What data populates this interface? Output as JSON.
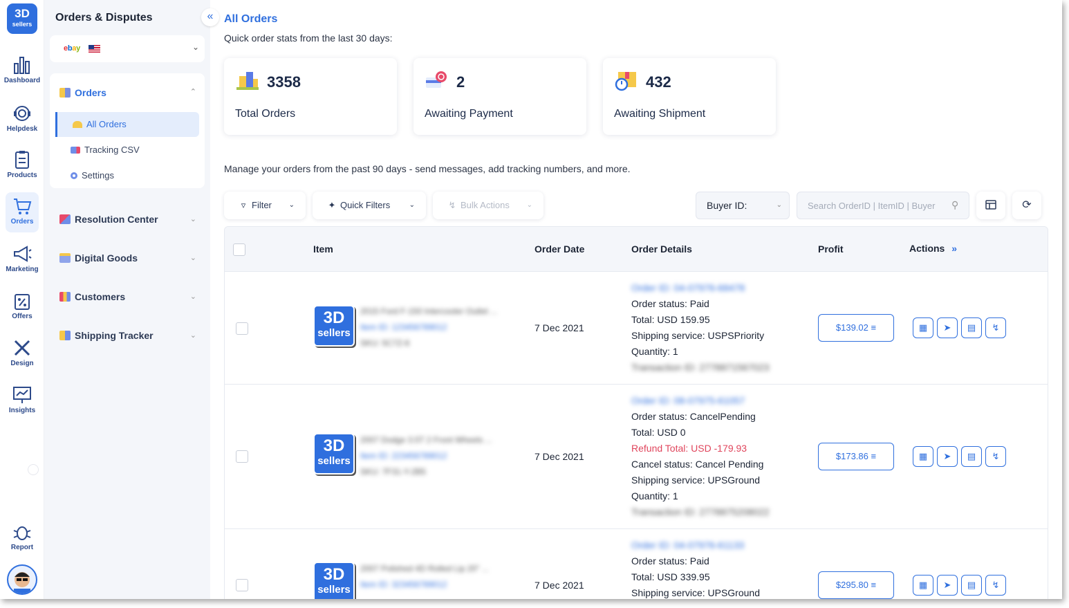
{
  "brand": {
    "logo_line1": "3D",
    "logo_line2": "sellers",
    "accent": "#2f6fde"
  },
  "rail": {
    "items": [
      {
        "label": "Dashboard",
        "icon": "bar-chart-icon"
      },
      {
        "label": "Helpdesk",
        "icon": "headset-icon"
      },
      {
        "label": "Products",
        "icon": "clipboard-icon"
      },
      {
        "label": "Orders",
        "icon": "cart-icon",
        "active": true
      },
      {
        "label": "Marketing",
        "icon": "megaphone-icon"
      },
      {
        "label": "Offers",
        "icon": "percent-tag-icon"
      },
      {
        "label": "Design",
        "icon": "design-tools-icon"
      },
      {
        "label": "Insights",
        "icon": "monitor-chart-icon"
      }
    ],
    "report_label": "Report"
  },
  "side": {
    "title": "Orders & Disputes",
    "marketplace": "ebay",
    "orders_group": "Orders",
    "orders_items": [
      "All Orders",
      "Tracking CSV",
      "Settings"
    ],
    "groups": [
      "Resolution Center",
      "Digital Goods",
      "Customers",
      "Shipping Tracker"
    ]
  },
  "main": {
    "title": "All Orders",
    "stats_subtitle": "Quick order stats from the last 30 days:",
    "stats": [
      {
        "value": "3358",
        "label": "Total Orders",
        "icon": "boxes-icon"
      },
      {
        "value": "2",
        "label": "Awaiting Payment",
        "icon": "card-clock-icon"
      },
      {
        "value": "432",
        "label": "Awaiting Shipment",
        "icon": "package-timer-icon"
      }
    ],
    "manage_text": "Manage your orders from the past 90 days - send messages, add tracking numbers, and more.",
    "toolbar": {
      "filter": "Filter",
      "quick_filters": "Quick Filters",
      "bulk_actions": "Bulk Actions",
      "buyer_id": "Buyer ID:",
      "search_placeholder": "Search OrderID | ItemID | Buyer"
    }
  },
  "table": {
    "headers": {
      "item": "Item",
      "order_date": "Order Date",
      "order_details": "Order Details",
      "profit": "Profit",
      "actions": "Actions"
    },
    "rows": [
      {
        "thumb_line1": "3D",
        "thumb_line2": "sellers",
        "item_title": "2015 Ford F-150 Intercooler Outlet ...",
        "item_id": "Item ID: 123456789012",
        "sku": "SKU: 5C7Z-6",
        "date": "7 Dec 2021",
        "order_id": "Order ID: 04-07976-68478",
        "status": "Order status: Paid",
        "total": "Total: USD 159.95",
        "shipping": "Shipping service: USPSPriority",
        "quantity": "Quantity: 1",
        "transaction": "Transaction ID: 2778871567023",
        "profit": "$139.02"
      },
      {
        "thumb_line1": "3D",
        "thumb_line2": "sellers",
        "item_title": "2007 Dodge 3.5T 2 Front Wheels ...",
        "item_id": "Item ID: 223456789012",
        "sku": "SKU: 7F31-Y-2B5",
        "date": "7 Dec 2021",
        "order_id": "Order ID: 08-07975-61057",
        "status": "Order status: CancelPending",
        "total": "Total: USD 0",
        "refund": "Refund Total: USD -179.93",
        "cancel": "Cancel status: Cancel Pending",
        "shipping": "Shipping service: UPSGround",
        "quantity": "Quantity: 1",
        "transaction": "Transaction ID: 2778875208022",
        "profit": "$173.86"
      },
      {
        "thumb_line1": "3D",
        "thumb_line2": "sellers",
        "item_title": "2007 Polished 4D Rolled Lip 20\" ...",
        "item_id": "Item ID: 323456789012",
        "date": "7 Dec 2021",
        "order_id": "Order ID: 04-07976-61133",
        "status": "Order status: Paid",
        "total": "Total: USD 339.95",
        "shipping": "Shipping service: UPSGround",
        "profit": "$295.80"
      }
    ]
  }
}
